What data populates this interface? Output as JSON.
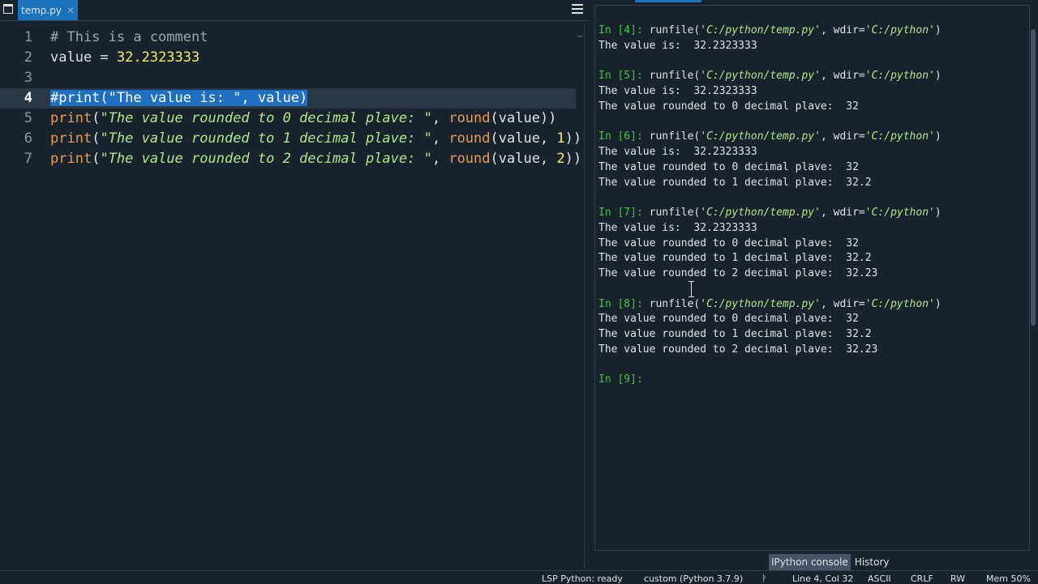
{
  "editor": {
    "tab": {
      "label": "temp.py",
      "close": "✕"
    },
    "lines": [
      {
        "num": "1",
        "parts": [
          {
            "cls": "cmt",
            "text": "# This is a comment"
          }
        ]
      },
      {
        "num": "2",
        "parts": [
          {
            "cls": "txt",
            "text": "value = "
          },
          {
            "cls": "num",
            "text": "32.2323333"
          }
        ]
      },
      {
        "num": "3",
        "parts": []
      },
      {
        "num": "4",
        "active": true,
        "selected": true,
        "parts": [
          {
            "cls": "sel",
            "text": "#print(\"The value is: \", value)"
          }
        ]
      },
      {
        "num": "5",
        "parts": [
          {
            "cls": "kw",
            "text": "print"
          },
          {
            "cls": "txt",
            "text": "("
          },
          {
            "cls": "str",
            "text": "\"The value rounded to 0 decimal plave: \""
          },
          {
            "cls": "txt",
            "text": ", "
          },
          {
            "cls": "kw",
            "text": "round"
          },
          {
            "cls": "txt",
            "text": "(value))"
          }
        ]
      },
      {
        "num": "6",
        "parts": [
          {
            "cls": "kw",
            "text": "print"
          },
          {
            "cls": "txt",
            "text": "("
          },
          {
            "cls": "str",
            "text": "\"The value rounded to 1 decimal plave: \""
          },
          {
            "cls": "txt",
            "text": ", "
          },
          {
            "cls": "kw",
            "text": "round"
          },
          {
            "cls": "txt",
            "text": "(value, "
          },
          {
            "cls": "num",
            "text": "1"
          },
          {
            "cls": "txt",
            "text": "))"
          }
        ]
      },
      {
        "num": "7",
        "parts": [
          {
            "cls": "kw",
            "text": "print"
          },
          {
            "cls": "txt",
            "text": "("
          },
          {
            "cls": "str",
            "text": "\"The value rounded to 2 decimal plave: \""
          },
          {
            "cls": "txt",
            "text": ", "
          },
          {
            "cls": "kw",
            "text": "round"
          },
          {
            "cls": "txt",
            "text": "(value, "
          },
          {
            "cls": "num",
            "text": "2"
          },
          {
            "cls": "txt",
            "text": "))"
          }
        ]
      }
    ]
  },
  "console": {
    "lines": [
      {
        "type": "prompt",
        "prompt": "In [4]:",
        "cmd": " runfile(",
        "path": "'C:/python/temp.py'",
        "mid": ", wdir=",
        "wdir": "'C:/python'",
        "end": ")"
      },
      {
        "type": "out",
        "text": "The value is:  32.2323333"
      },
      {
        "type": "blank"
      },
      {
        "type": "prompt",
        "prompt": "In [5]:",
        "cmd": " runfile(",
        "path": "'C:/python/temp.py'",
        "mid": ", wdir=",
        "wdir": "'C:/python'",
        "end": ")"
      },
      {
        "type": "out",
        "text": "The value is:  32.2323333"
      },
      {
        "type": "out",
        "text": "The value rounded to 0 decimal plave:  32"
      },
      {
        "type": "blank"
      },
      {
        "type": "prompt",
        "prompt": "In [6]:",
        "cmd": " runfile(",
        "path": "'C:/python/temp.py'",
        "mid": ", wdir=",
        "wdir": "'C:/python'",
        "end": ")"
      },
      {
        "type": "out",
        "text": "The value is:  32.2323333"
      },
      {
        "type": "out",
        "text": "The value rounded to 0 decimal plave:  32"
      },
      {
        "type": "out",
        "text": "The value rounded to 1 decimal plave:  32.2"
      },
      {
        "type": "blank"
      },
      {
        "type": "prompt",
        "prompt": "In [7]:",
        "cmd": " runfile(",
        "path": "'C:/python/temp.py'",
        "mid": ", wdir=",
        "wdir": "'C:/python'",
        "end": ")"
      },
      {
        "type": "out",
        "text": "The value is:  32.2323333"
      },
      {
        "type": "out",
        "text": "The value rounded to 0 decimal plave:  32"
      },
      {
        "type": "out",
        "text": "The value rounded to 1 decimal plave:  32.2"
      },
      {
        "type": "out",
        "text": "The value rounded to 2 decimal plave:  32.23"
      },
      {
        "type": "blank"
      },
      {
        "type": "prompt",
        "prompt": "In [8]:",
        "cmd": " runfile(",
        "path": "'C:/python/temp.py'",
        "mid": ", wdir=",
        "wdir": "'C:/python'",
        "end": ")"
      },
      {
        "type": "out",
        "text": "The value rounded to 0 decimal plave:  32"
      },
      {
        "type": "out",
        "text": "The value rounded to 1 decimal plave:  32.2"
      },
      {
        "type": "out",
        "text": "The value rounded to 2 decimal plave:  32.23"
      },
      {
        "type": "blank"
      },
      {
        "type": "prompt_only",
        "prompt": "In [9]:"
      }
    ]
  },
  "bottom_tabs": {
    "console": "IPython console",
    "history": "History"
  },
  "statusbar": {
    "lsp": "LSP Python: ready",
    "env": "custom (Python 3.7.9)",
    "vcs": "ᚹ",
    "position": "Line 4, Col 32",
    "encoding": "ASCII",
    "eol": "CRLF",
    "permissions": "RW",
    "memory": "Mem 50%"
  },
  "colors": {
    "accent": "#1a72bb",
    "background": "#19232d",
    "prompt": "#2fd02f",
    "string": "#b0e686",
    "keyword": "#e89b4c",
    "number": "#faed5c"
  }
}
